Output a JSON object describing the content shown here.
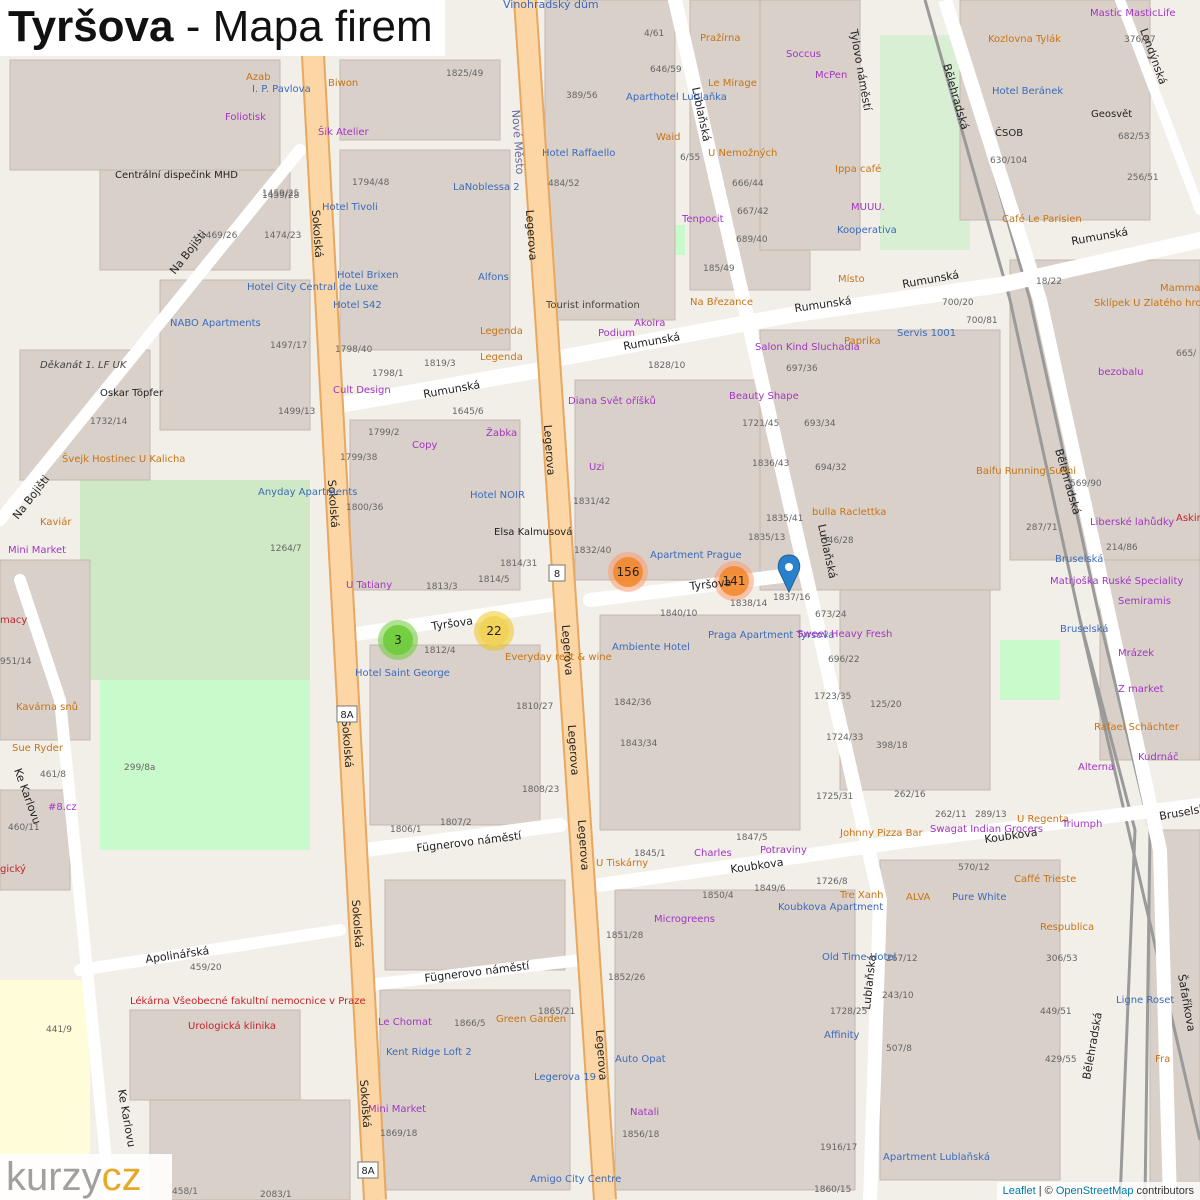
{
  "title": {
    "bold": "Tyršova",
    "rest": " - Mapa firem"
  },
  "brand": {
    "k": "kurzy",
    "c": "cz"
  },
  "attribution": {
    "leaflet": "Leaflet",
    "sep": " | © ",
    "osm": "OpenStreetMap",
    "suffix": " contributors"
  },
  "clusters": [
    {
      "id": "cluster-3",
      "count": "3",
      "color": "green"
    },
    {
      "id": "cluster-22",
      "count": "22",
      "color": "yellow"
    },
    {
      "id": "cluster-156",
      "count": "156",
      "color": "orange"
    },
    {
      "id": "cluster-141",
      "count": "141",
      "color": "orange"
    }
  ],
  "colors": {
    "main_road": "#fcd6a4",
    "main_road_casing": "#e8a860",
    "road": "#ffffff",
    "road_casing": "#cfc9c0",
    "building": "#d9d0c9",
    "park": "#c8facc",
    "railway": "#9a9a9a",
    "marker": "#2a81cb"
  },
  "streets": {
    "sokolska": "Sokolská",
    "legerova": "Legerova",
    "lublanska": "Lublaňská",
    "belehradska": "Bělehradská",
    "rumunska": "Rumunská",
    "tyrsova": "Tyršova",
    "koubkova": "Koubkova",
    "fugnerovo": "Fügnerovo náměstí",
    "apolinarska": "Apolinářská",
    "ke_karlovu": "Ke Karlovu",
    "na_bojisti": "Na Bojišti",
    "tylovo": "Tylovo náměstí",
    "londynska": "Londýnská",
    "saratickova": "Šafaříkova",
    "bruselska": "Bruselská",
    "vinohradsky": "Vinohradský dům",
    "nove_mesto": "Nové Město"
  },
  "labels": {
    "ip_pavlova": "I. P. Pavlova",
    "azab": "Azab",
    "biwon": "Biwon",
    "foliotisk": "Foliotisk",
    "sik": "Šik Atelier",
    "dispecink": "Centrální dispečink MHD",
    "hotel_tivoli": "Hotel Tivoli",
    "hotel_brixen": "Hotel Brixen",
    "hotel_s42": "Hotel S42",
    "lanoblessa": "LaNoblessa 2",
    "alfons": "Alfons",
    "legenda": "Legenda",
    "cult": "Cult Design",
    "nabo": "NABO Apartments",
    "hotel_city": "Hotel City Central de Luxe",
    "dekanat": "Děkanát 1. LF UK",
    "oskar": "Oskar Töpfer",
    "svejk": "Švejk Hostinec U Kalicha",
    "copy": "Copy",
    "zabka": "Žabka",
    "anyday": "Anyday Apartments",
    "hotel_noir": "Hotel NOIR",
    "elsa": "Elsa Kalmusová",
    "kaviar": "Kaviár",
    "mini_market": "Mini Market",
    "u_tatiany": "U Tatiany",
    "hotel_saint": "Hotel Saint George",
    "everyday": "Everyday rest & wine",
    "kavarna": "Kavárna snů",
    "sue": "Sue Ryder",
    "hash8": "#8.cz",
    "lekarna": "Lékárna Všeobecné fakultní nemocnice v Praze",
    "urologicka": "Urologická klinika",
    "le_chomat": "Le Chomat",
    "kent": "Kent Ridge Loft 2",
    "green_garden": "Green Garden",
    "auto_opat": "Auto Opat",
    "legerova19": "Legerova 19",
    "natali": "Natali",
    "amigo": "Amigo City Centre",
    "mini_market2": "Mini Market",
    "prazirna": "Pražírna",
    "soccus": "Soccus",
    "le_mirage": "Le Mirage",
    "mcpen": "McPen",
    "aparthotel": "Aparthotel Lublaňka",
    "hotel_raffaello": "Hotel Raffaello",
    "waid": "Waid",
    "u_nemoznych": "U Nemožných",
    "ippa": "Ippa café",
    "muuu": "MUUU.",
    "kooperativa": "Kooperativa",
    "tenpocit": "Tenpocit",
    "tourist": "Tourist information",
    "podium": "Podium",
    "akoira": "Akoira",
    "na_brezance": "Na Březance",
    "misto": "Místo",
    "salon": "Salon Kind Sluchadla",
    "paprika": "Paprika",
    "servis": "Servis 1001",
    "diana": "Diana Svět oříšků",
    "beauty": "Beauty Shape",
    "uzi": "Uzi",
    "apartment_prague": "Apartment Prague",
    "bulla": "bulla Raclettka",
    "ambiente": "Ambiente Hotel",
    "praga_apartment": "Praga Apartment Tyrsova",
    "sweet": "Sweet Heavy Fresh",
    "u_tiskarny": "U Tiskárny",
    "charles": "Charles",
    "potraviny": "Potraviny",
    "johnny": "Johnny Pizza Bar",
    "tre_xanh": "Tre Xanh",
    "microgreens": "Microgreens",
    "koubkova_apt": "Koubkova Apartment",
    "old_time": "Old Time Hotel",
    "affinity": "Affinity",
    "apartment_lublanska": "Apartment Lublaňská",
    "kozlovna": "Kozlovna Tylák",
    "hotel_beranek": "Hotel Beránek",
    "csob": "ČSOB",
    "geosvet": "Geosvět",
    "cafe_le_parisien": "Café Le Parisien",
    "sklipek": "Sklípek U Zlatého hroznu",
    "mamma": "Mamma Coffee",
    "bezobalu": "bezobalu",
    "baifu": "Baifu Running Sushi",
    "liberske": "Liberské lahůdky",
    "matrjoska": "Matrjoška Ruské Speciality",
    "semiramis": "Semiramis",
    "bruselska_shop": "Bruselská",
    "mrazek": "Mrázek",
    "z_market": "Z market",
    "rafael": "Rafael Schächter",
    "alterna": "Alterna",
    "kudrnac": "Kudrnáč",
    "swagat": "Swagat Indian Grocers",
    "u_regenta": "U Regenta",
    "triumph": "Triumph",
    "caffe_trieste": "Caffé Trieste",
    "alva": "ALVA",
    "pure_white": "Pure White",
    "respublica": "Respublica",
    "ligne_roset": "Ligne Roset",
    "fra": "Fra",
    "masticlife": "Mastic MasticLife",
    "askin": "Askin",
    "pharmacy": "macy",
    "gicky": "gický"
  },
  "numbers": [
    "1459/28",
    "1459/25",
    "1469/26",
    "1474/23",
    "1497/17",
    "1499/13",
    "1732/14",
    "1798/40",
    "1819/3",
    "1798/1",
    "1794/48",
    "1825/49",
    "1645/6",
    "1799/2",
    "1799/38",
    "1800/36",
    "1813/3",
    "1814/5",
    "1814/31",
    "1812/4",
    "1810/27",
    "1808/23",
    "1807/2",
    "1806/1",
    "1264/7",
    "299/8a",
    "461/8",
    "460/11",
    "459/20",
    "441/9",
    "1866/5",
    "1865/21",
    "1869/18",
    "2083/1",
    "458/1",
    "1856/18",
    "1852/26",
    "1851/28",
    "1850/4",
    "1849/6",
    "1845/1",
    "1847/5",
    "1843/34",
    "1842/36",
    "1840/10",
    "1838/14",
    "1837/16",
    "1836/43",
    "1835/41",
    "1835/13",
    "1832/40",
    "1831/42",
    "1828/10",
    "1721/45",
    "697/36",
    "693/34",
    "694/32",
    "346/28",
    "673/24",
    "696/22",
    "1723/35",
    "125/20",
    "1724/33",
    "398/18",
    "1725/31",
    "262/16",
    "289/13",
    "262/11",
    "570/12",
    "1726/8",
    "267/12",
    "306/53",
    "243/10",
    "1728/25",
    "507/8",
    "449/51",
    "429/55",
    "1916/17",
    "1860/15",
    "4/61",
    "646/59",
    "389/56",
    "484/52",
    "6/55",
    "666/44",
    "667/42",
    "689/40",
    "185/49",
    "700/20",
    "700/81",
    "18/22",
    "376/57",
    "682/53",
    "630/104",
    "256/51",
    "287/71",
    "569/90",
    "214/86",
    "665/",
    "951/14"
  ],
  "route_numbers": [
    "8",
    "8A",
    "8A"
  ]
}
